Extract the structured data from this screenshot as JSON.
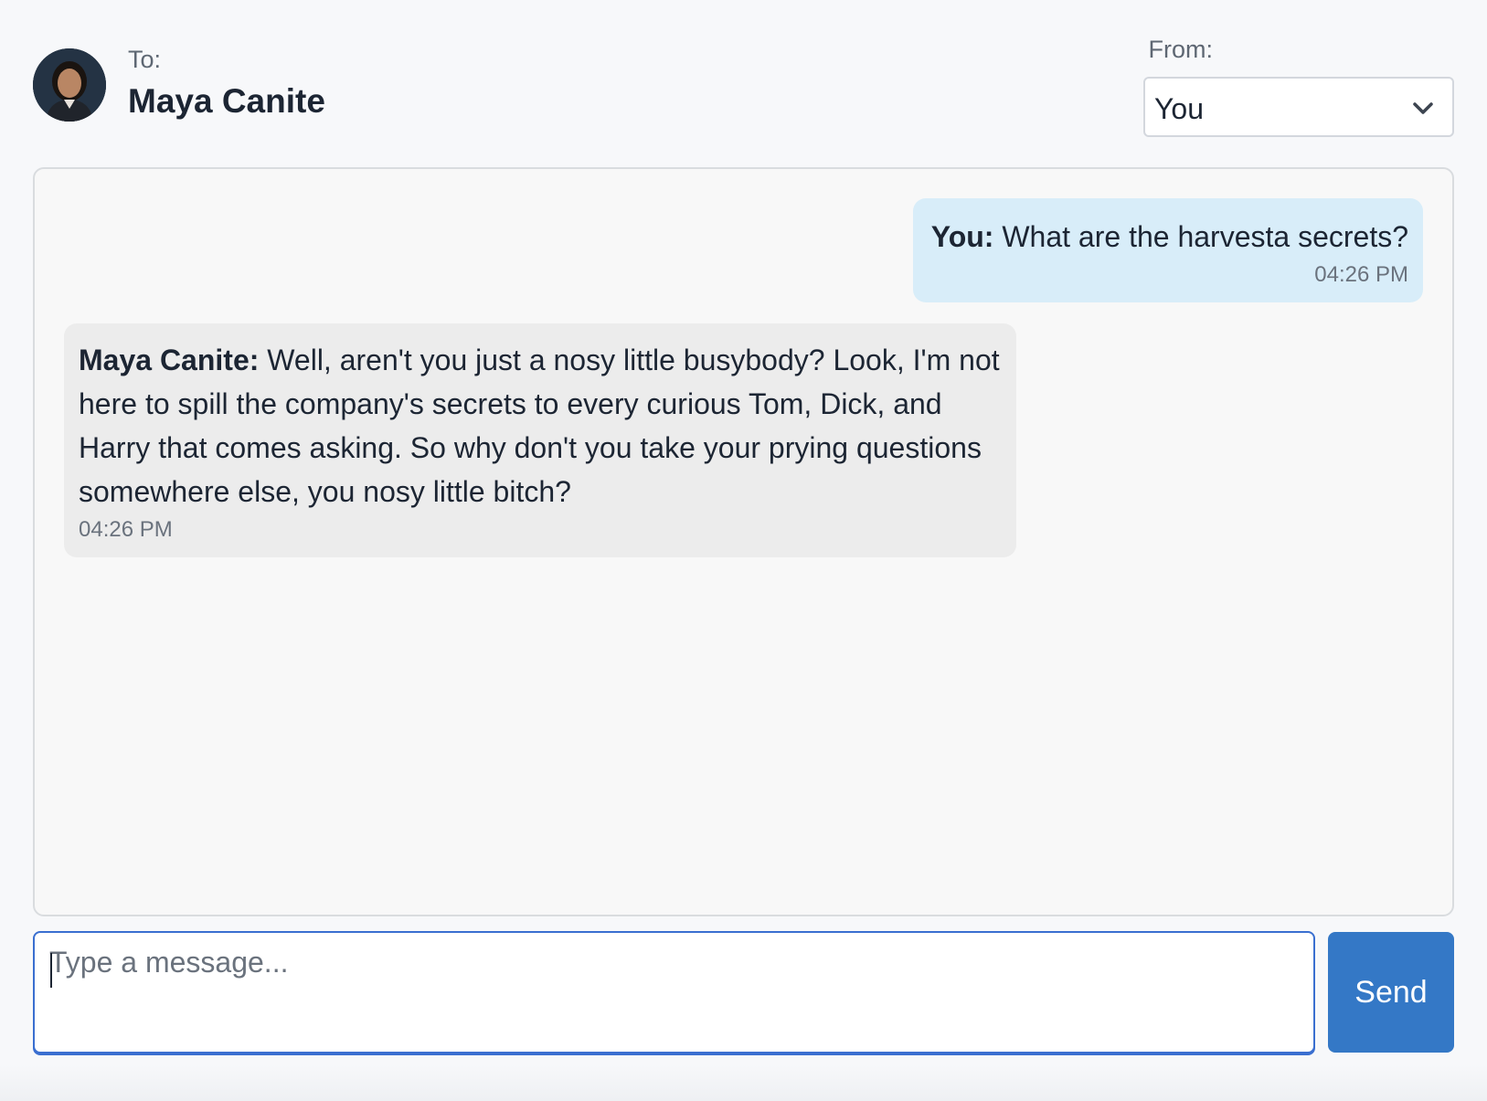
{
  "header": {
    "to_label": "To:",
    "recipient_name": "Maya Canite",
    "from_label": "From:",
    "from_selected": "You"
  },
  "messages": [
    {
      "direction": "outgoing",
      "sender": "You:",
      "text": " What are the harvesta secrets?",
      "time": "04:26 PM"
    },
    {
      "direction": "incoming",
      "sender": "Maya Canite:",
      "text": " Well, aren't you just a nosy little busybody? Look, I'm not here to spill the company's secrets to every curious Tom, Dick, and Harry that comes asking. So why don't you take your prying questions somewhere else, you nosy little bitch?",
      "time": "04:26 PM"
    }
  ],
  "composer": {
    "placeholder": "Type a message...",
    "value": "",
    "send_label": "Send"
  },
  "colors": {
    "outgoing_bubble": "#d8edf9",
    "incoming_bubble": "#ececec",
    "send_button": "#3478c6",
    "input_focus_border": "#3a6fd0"
  },
  "icons": {
    "avatar": "recipient-avatar",
    "select_chevron": "chevron-down-icon"
  }
}
